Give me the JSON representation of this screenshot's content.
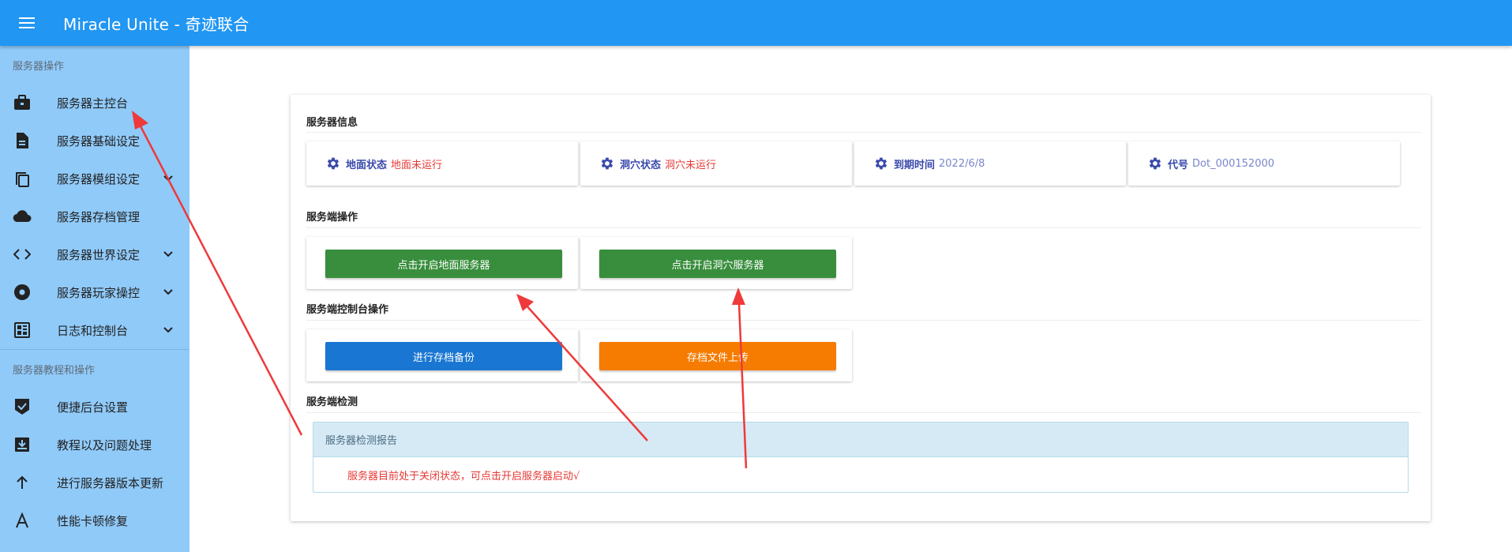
{
  "app": {
    "title": "Miracle Unite - 奇迹联合"
  },
  "sidebar": {
    "sections": [
      {
        "heading": "服务器操作",
        "items": [
          {
            "label": "服务器主控台",
            "icon": "briefcase-icon",
            "expandable": false
          },
          {
            "label": "服务器基础设定",
            "icon": "document-icon",
            "expandable": false
          },
          {
            "label": "服务器模组设定",
            "icon": "copy-icon",
            "expandable": true
          },
          {
            "label": "服务器存档管理",
            "icon": "cloud-icon",
            "expandable": false
          },
          {
            "label": "服务器世界设定",
            "icon": "code-icon",
            "expandable": true
          },
          {
            "label": "服务器玩家操控",
            "icon": "record-icon",
            "expandable": true
          },
          {
            "label": "日志和控制台",
            "icon": "dashboard-icon",
            "expandable": true
          }
        ]
      },
      {
        "heading": "服务器教程和操作",
        "items": [
          {
            "label": "便捷后台设置",
            "icon": "verified-icon",
            "expandable": false
          },
          {
            "label": "教程以及问题处理",
            "icon": "inbox-icon",
            "expandable": false
          },
          {
            "label": "进行服务器版本更新",
            "icon": "arrow-up-icon",
            "expandable": false
          },
          {
            "label": "性能卡顿修复",
            "icon": "font-a-icon",
            "expandable": false
          }
        ]
      }
    ]
  },
  "main": {
    "server_info": {
      "title": "服务器信息",
      "items": [
        {
          "key": "地面状态",
          "value": "地面未运行",
          "tone": "red"
        },
        {
          "key": "洞穴状态",
          "value": "洞穴未运行",
          "tone": "red"
        },
        {
          "key": "到期时间",
          "value": "2022/6/8",
          "tone": "blue"
        },
        {
          "key": "代号",
          "value": "Dot_000152000",
          "tone": "blue"
        }
      ]
    },
    "server_ops": {
      "title": "服务端操作",
      "start_surface": "点击开启地面服务器",
      "start_caves": "点击开启洞穴服务器"
    },
    "console_ops": {
      "title": "服务端控制台操作",
      "backup": "进行存档备份",
      "upload": "存档文件上传"
    },
    "detection": {
      "title": "服务端检测",
      "report_title": "服务器检测报告",
      "report_message": "服务器目前处于关闭状态，可点击开启服务器启动√"
    }
  },
  "colors": {
    "appbar": "#2196f3",
    "sidebar": "#90caf9",
    "green_button": "#388e3c",
    "blue_button": "#1976d2",
    "orange_button": "#f57c00",
    "annotation_arrow": "#ee3a3a"
  }
}
